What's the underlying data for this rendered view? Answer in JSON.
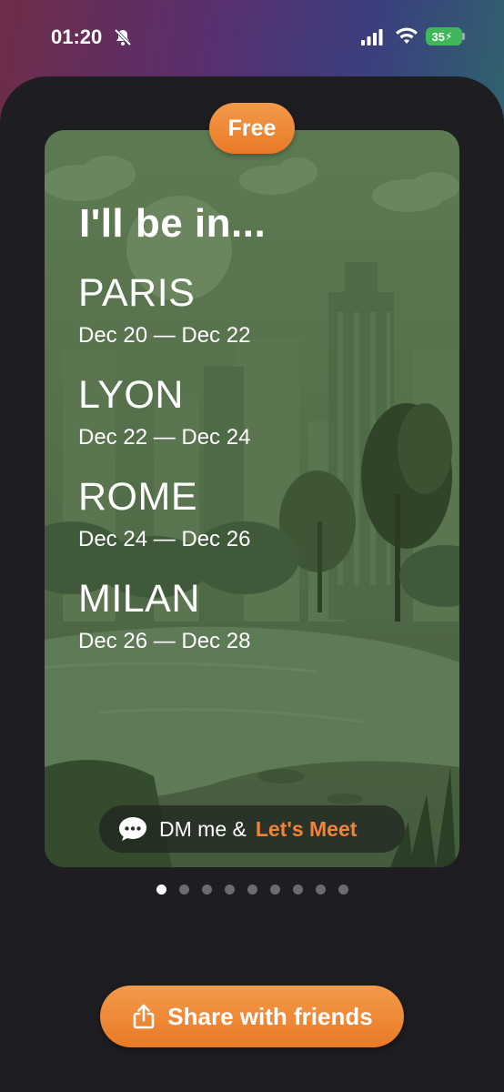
{
  "status_bar": {
    "time": "01:20",
    "battery": "35"
  },
  "badge": "Free",
  "card": {
    "title": "I'll be in...",
    "stops": [
      {
        "city": "PARIS",
        "dates": "Dec 20 — Dec 22"
      },
      {
        "city": "LYON",
        "dates": "Dec 22 — Dec 24"
      },
      {
        "city": "ROME",
        "dates": "Dec 24 — Dec 26"
      },
      {
        "city": "MILAN",
        "dates": "Dec 26 — Dec 28"
      }
    ],
    "dm_text": "DM me &",
    "dm_cta": "Let's Meet"
  },
  "pager": {
    "count": 9,
    "active_index": 0
  },
  "share_button": "Share with friends",
  "colors": {
    "accent": "#f0843a",
    "sheet": "#1e1d21",
    "card_green": "#56704b"
  }
}
